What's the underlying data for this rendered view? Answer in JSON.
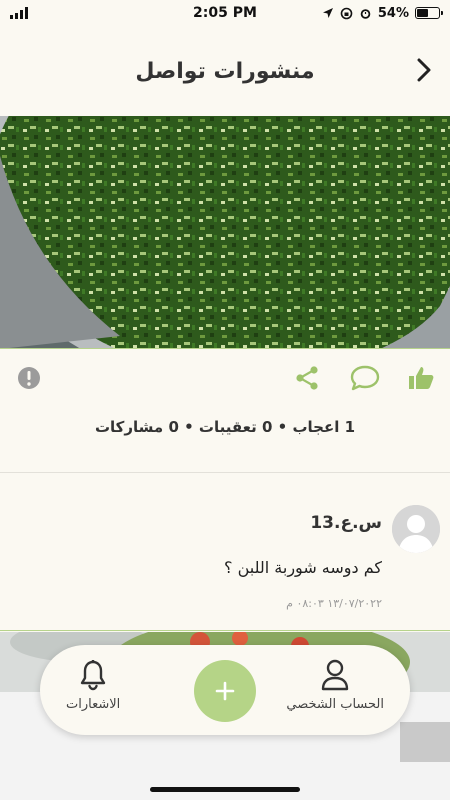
{
  "status_bar": {
    "time": "2:05 PM",
    "battery": "54%",
    "battery_level": 0.54
  },
  "header": {
    "title": "منشورات تواصل",
    "back_icon": "chevron-right-icon"
  },
  "post": {
    "image_description_icon": "food-photo",
    "actions": {
      "like_icon": "thumbs-up-icon",
      "comment_icon": "comment-icon",
      "share_icon": "share-icon",
      "report_icon": "report-icon"
    },
    "counts": "1 اعجاب • 0 تعقيبات • 0 مشاركات"
  },
  "comment": {
    "author": "س.ع.13",
    "text": "كم دوسه شوربة اللبن ؟",
    "date": "١٣/٠٧/٢٠٢٢ ٠٨:٠٣ م"
  },
  "bottom_nav": {
    "profile_label": "الحساب الشخصي",
    "notifications_label": "الاشعارات",
    "add_label": "+"
  },
  "colors": {
    "accent": "#9dc26a",
    "background": "#fbf9f2",
    "fab": "#b5d487",
    "report": "#9b9b9b"
  }
}
